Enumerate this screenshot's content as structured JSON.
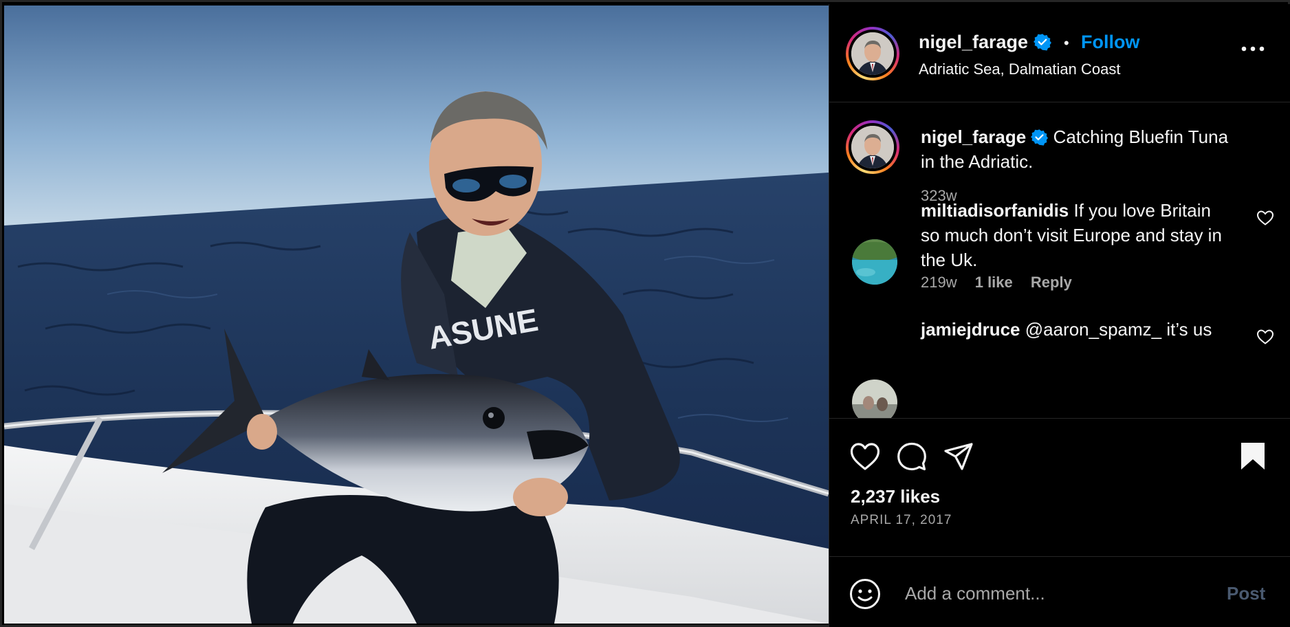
{
  "post": {
    "username": "nigel_farage",
    "follow_label": "Follow",
    "separator": "•",
    "location": "Adriatic Sea, Dalmatian Coast"
  },
  "caption": {
    "username": "nigel_farage",
    "text": "Catching Bluefin Tuna in the Adriatic.",
    "age": "323w"
  },
  "comments": [
    {
      "username": "miltiadisorfanidis",
      "text": "If you love Britain so much don’t visit Europe and stay in the Uk.",
      "age": "219w",
      "likes": "1 like",
      "reply_label": "Reply"
    },
    {
      "username": "jamiejdruce",
      "text": "@aaron_spamz_ it’s us",
      "age": "",
      "likes": "",
      "reply_label": ""
    }
  ],
  "engagement": {
    "likes": "2,237 likes",
    "date": "APRIL 17, 2017"
  },
  "comment_box": {
    "placeholder": "Add a comment...",
    "post_label": "Post"
  },
  "icons": {
    "verified": "verified-badge-icon",
    "more": "more-options-icon",
    "like": "heart-icon",
    "comment": "comment-icon",
    "share": "share-icon",
    "save": "bookmark-icon",
    "emoji": "emoji-icon"
  },
  "colors": {
    "accent": "#0095f6",
    "background": "#000000",
    "muted_text": "#a8a8a8",
    "divider": "#262626"
  }
}
